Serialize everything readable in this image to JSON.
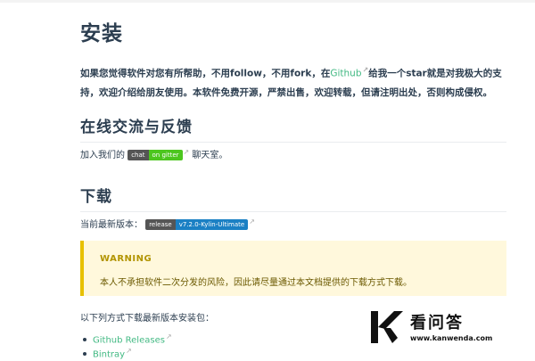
{
  "page": {
    "title": "安装",
    "intro": {
      "part1": "如果您觉得软件对您有所帮助，不用follow，不用fork，在",
      "github_link": "Github",
      "part2": "给我一个star就是对我极大的支持，欢迎介绍给朋友使用。本软件免费开源，严禁出售，欢迎转载，但请注明出处，否则构成侵权。"
    }
  },
  "feedback": {
    "heading": "在线交流与反馈",
    "prefix": "加入我们的",
    "badge_left": "chat",
    "badge_right": "on gitter",
    "suffix": "聊天室。"
  },
  "download": {
    "heading": "下载",
    "version_label": "当前最新版本：",
    "badge_left": "release",
    "badge_right": "v7.2.0-Kylin-Ultimate",
    "warning": {
      "title": "WARNING",
      "text": "本人不承担软件二次分发的风险，因此请尽量通过本文档提供的下载方式下载。"
    },
    "methods_label": "以下列方式下载最新版本安装包：",
    "links": [
      "Github Releases",
      "Bintray"
    ]
  },
  "watermark": {
    "title": "看问答",
    "url": "www.kanwenda.com"
  },
  "colors": {
    "link": "#42b983",
    "warning_border": "#e7c000",
    "warning_bg": "#fff8dc",
    "badge_green": "#4cc61e",
    "badge_blue": "#1b80c4"
  }
}
